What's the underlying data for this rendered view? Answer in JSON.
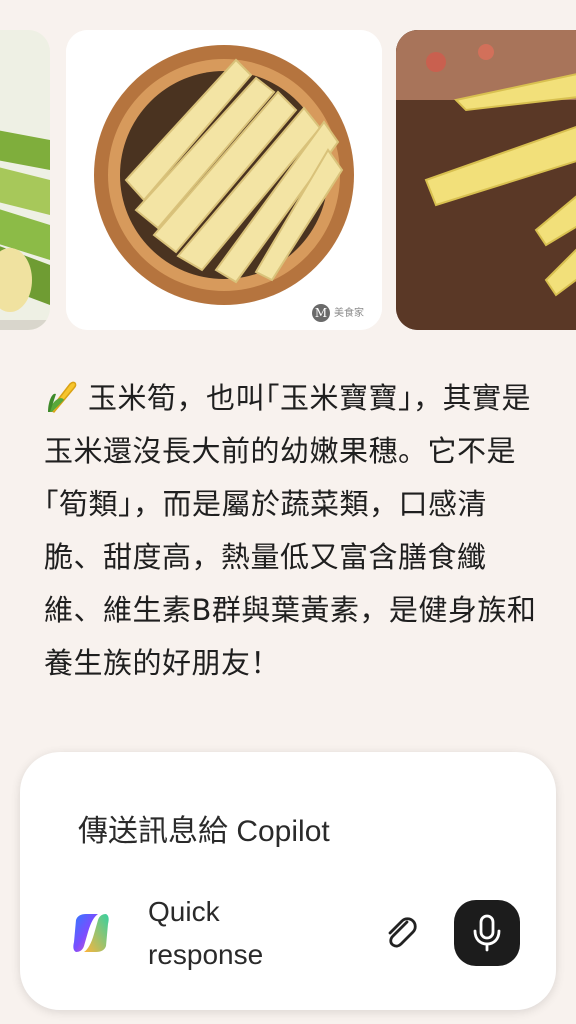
{
  "answer": {
    "text": "玉米筍，也叫｢玉米寶寶｣，其實是玉米還沒長大前的幼嫩果穗。它不是｢筍類｣，而是屬於蔬菜類，口感清脆、甜度高，熱量低又富含膳食纖維、維生素B群與葉黃素，是健身族和養生族的好朋友！",
    "leading_icon": "corn-icon"
  },
  "images": {
    "center_watermark": "美食家"
  },
  "composer": {
    "placeholder": "傳送訊息給 Copilot",
    "quick_response_label": "Quick response",
    "attach_icon": "paperclip-icon",
    "mic_icon": "microphone-icon",
    "brand_icon": "copilot-logo-icon"
  },
  "colors": {
    "background": "#f8f2ee",
    "mic_button": "#1c1c1c",
    "text": "#1f1f1f"
  }
}
